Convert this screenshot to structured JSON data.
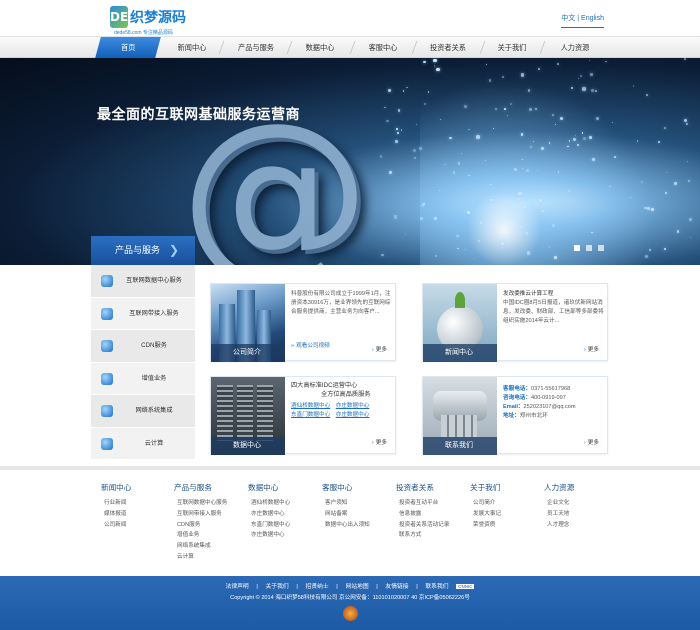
{
  "header": {
    "logo_mark": "DE",
    "logo_text": "织梦源码",
    "logo_sub": "dede58.com 专注精品源码",
    "lang_cn": "中文",
    "lang_sep": "|",
    "lang_en": "English"
  },
  "nav": {
    "items": [
      "首页",
      "新闻中心",
      "产品与服务",
      "数据中心",
      "客服中心",
      "投资者关系",
      "关于我们",
      "人力资源"
    ]
  },
  "banner": {
    "title": "最全面的互联网基础服务运营商"
  },
  "sidebar": {
    "heading": "产品与服务",
    "items": [
      "互联网数据中心服务",
      "互联网带接入服务",
      "CDN服务",
      "增值业务",
      "网络系统集成",
      "云计算"
    ]
  },
  "cards": {
    "company": {
      "caption": "公司简介",
      "text": "科普股份有限公司成立于1999年1月，注册资本30916万，是业界领先的互联网综合服务提供商，主营业务为向客户...",
      "link": "观看公司视频",
      "more": "更多"
    },
    "news": {
      "caption": "新闻中心",
      "title": "发改委推云计算工程",
      "text": "中国IDC圈8月5日报道，诸玖伏新网站消息，发改委、财政部、工信部等多部委将组织实施2014年云计...",
      "more": "更多"
    },
    "datacenter": {
      "caption": "数据中心",
      "title": "四大高标准IDC运营中心",
      "subtitle": "全方位高品质服务",
      "links": [
        "酒仙桥数据中心",
        "亦庄数据中心",
        "东直门数据中心",
        "亦庄数据中心"
      ],
      "more": "更多"
    },
    "contact": {
      "caption": "联系我们",
      "service_label": "客服电话：",
      "service_value": "0371-55617968",
      "consult_label": "咨询电话：",
      "consult_value": "400-0919-097",
      "email_label": "Email：",
      "email_value": "252023107@qq.com",
      "address_label": "地址：",
      "address_value": "郑州市北环",
      "more": "更多"
    }
  },
  "footer": {
    "columns": [
      {
        "title": "新闻中心",
        "items": [
          "行业新闻",
          "媒体报道",
          "公司新闻"
        ]
      },
      {
        "title": "产品与服务",
        "items": [
          "互联网数据中心服务",
          "互联网带接入服务",
          "CDN服务",
          "增值业务",
          "网络系统集成",
          "云计算"
        ]
      },
      {
        "title": "数据中心",
        "items": [
          "酒仙桥数据中心",
          "亦庄数据中心",
          "东直门数据中心",
          "亦庄数据中心"
        ]
      },
      {
        "title": "客服中心",
        "items": [
          "客户须知",
          "网站备案",
          "数据中心出入须知"
        ]
      },
      {
        "title": "投资者关系",
        "items": [
          "投资者互动平台",
          "信息披露",
          "投资者关系活动记录",
          "联系方式"
        ]
      },
      {
        "title": "关于我们",
        "items": [
          "公司简介",
          "发展大事记",
          "荣誉资质"
        ]
      },
      {
        "title": "人力资源",
        "items": [
          "企业文化",
          "员工天地",
          "人才理念"
        ]
      }
    ],
    "bottom_links": [
      "法律声明",
      "|",
      "关于我们",
      "|",
      "招贤纳士",
      "|",
      "网站地图",
      "|",
      "友情链接",
      "|",
      "联系我们"
    ],
    "cnnic": "CNNIC",
    "copyright": "Copyright © 2014  海口织梦58科技有限公司  京公网安备：110101020007 40  京ICP备05062226号"
  }
}
